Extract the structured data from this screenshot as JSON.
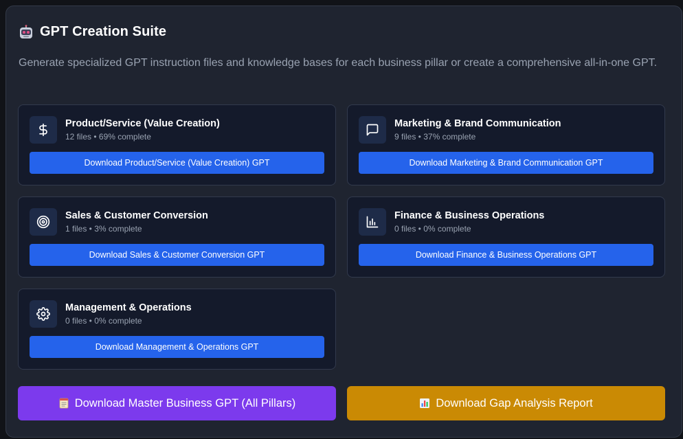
{
  "header": {
    "title": "GPT Creation Suite",
    "icon": "robot-icon",
    "subtitle": "Generate specialized GPT instruction files and knowledge bases for each business pillar or create a comprehensive all-in-one GPT."
  },
  "pillars": [
    {
      "icon": "dollar-icon",
      "title": "Product/Service (Value Creation)",
      "meta": "12 files • 69% complete",
      "button": "Download Product/Service (Value Creation) GPT"
    },
    {
      "icon": "message-square-icon",
      "title": "Marketing & Brand Communication",
      "meta": "9 files • 37% complete",
      "button": "Download Marketing & Brand Communication GPT"
    },
    {
      "icon": "target-icon",
      "title": "Sales & Customer Conversion",
      "meta": "1 files • 3% complete",
      "button": "Download Sales & Customer Conversion GPT"
    },
    {
      "icon": "bar-chart-icon",
      "title": "Finance & Business Operations",
      "meta": "0 files • 0% complete",
      "button": "Download Finance & Business Operations GPT"
    },
    {
      "icon": "gear-icon",
      "title": "Management & Operations",
      "meta": "0 files • 0% complete",
      "button": "Download Management & Operations GPT"
    }
  ],
  "actions": {
    "master_label": "Download Master Business GPT (All Pillars)",
    "master_icon": "notepad-icon",
    "gap_label": "Download Gap Analysis Report",
    "gap_icon": "bar-chart-icon"
  },
  "colors": {
    "panel_bg": "#1f2430",
    "card_bg": "#141a2b",
    "primary_blue": "#2563eb",
    "master_purple": "#7c3aed",
    "gap_amber": "#ca8a04"
  }
}
